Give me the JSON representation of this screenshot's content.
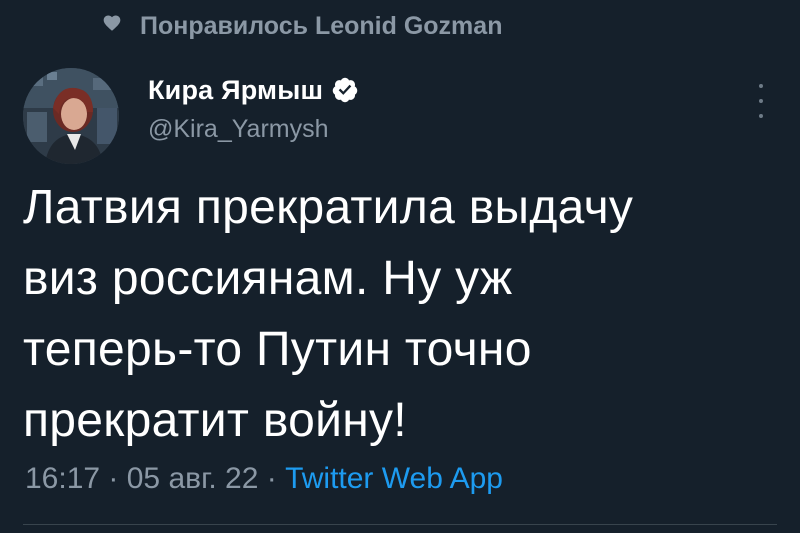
{
  "social_context": {
    "icon": "heart-icon",
    "text": "Понравилось Leonid Gozman"
  },
  "author": {
    "display_name": "Кира Ярмыш",
    "handle": "@Kira_Yarmysh",
    "verified": true,
    "avatar": "avatar-photo"
  },
  "tweet": {
    "lines": [
      "Латвия прекратила выдачу",
      "виз россиянам. Ну уж",
      "теперь-то Путин точно",
      "прекратит войну!"
    ]
  },
  "meta": {
    "time": "16:17",
    "separator": " · ",
    "date": "05 авг. 22",
    "source": "Twitter Web App"
  },
  "colors": {
    "background": "#15202b",
    "secondary_text": "#8b98a5",
    "accent": "#1d9bf0"
  }
}
